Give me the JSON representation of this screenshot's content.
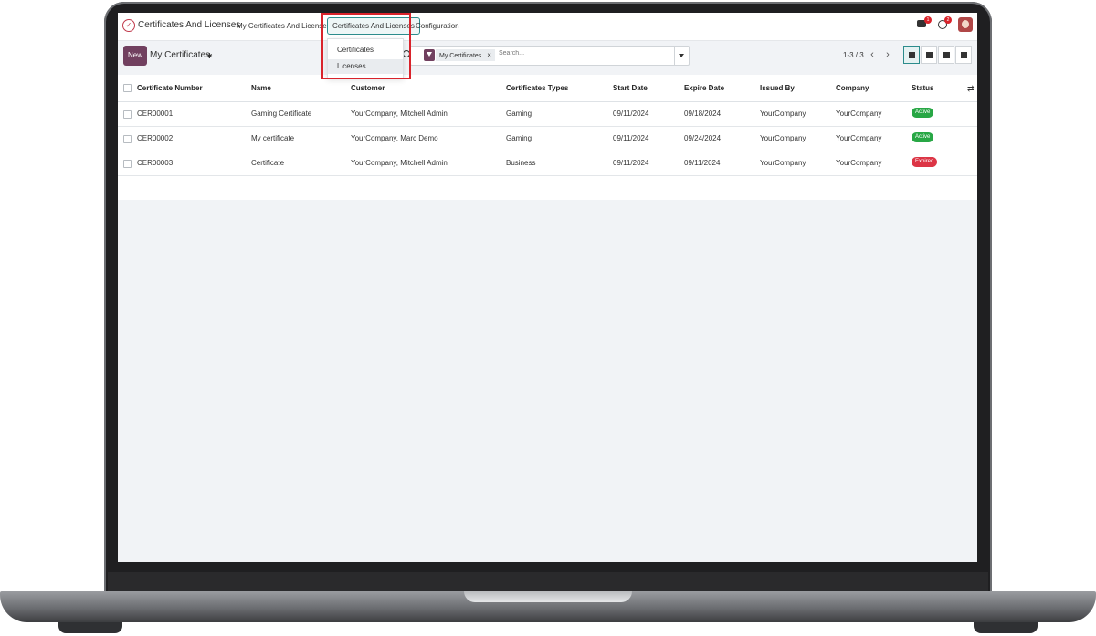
{
  "app": {
    "name": "Certificates And Licenses"
  },
  "menu": {
    "my_certs": "My Certificates And Licenses",
    "certs_and_licenses": "Certificates And Licenses",
    "configuration": "Configuration",
    "dropdown": [
      "Certificates",
      "Licenses"
    ]
  },
  "notifications": {
    "chat_count": "1",
    "activity_count": "2"
  },
  "control": {
    "new_label": "New",
    "breadcrumb": "My Certificates"
  },
  "search": {
    "facet": "My Certificates",
    "placeholder": "Search..."
  },
  "pager": {
    "text": "1-3 / 3"
  },
  "table": {
    "headers": [
      "Certificate Number",
      "Name",
      "Customer",
      "Certificates Types",
      "Start Date",
      "Expire Date",
      "Issued By",
      "Company",
      "Status"
    ],
    "rows": [
      [
        "CER00001",
        "Gaming Certificate",
        "YourCompany, Mitchell Admin",
        "Gaming",
        "09/11/2024",
        "09/18/2024",
        "YourCompany",
        "YourCompany",
        "Active"
      ],
      [
        "CER00002",
        "My certificate",
        "YourCompany, Marc Demo",
        "Gaming",
        "09/11/2024",
        "09/24/2024",
        "YourCompany",
        "YourCompany",
        "Active"
      ],
      [
        "CER00003",
        "Certificate",
        "YourCompany, Mitchell Admin",
        "Business",
        "09/11/2024",
        "09/11/2024",
        "YourCompany",
        "YourCompany",
        "Expired"
      ]
    ]
  },
  "colors": {
    "brand": "#71405f",
    "active": "#28a745",
    "expired": "#dc3545",
    "highlight": "#d9232b"
  }
}
